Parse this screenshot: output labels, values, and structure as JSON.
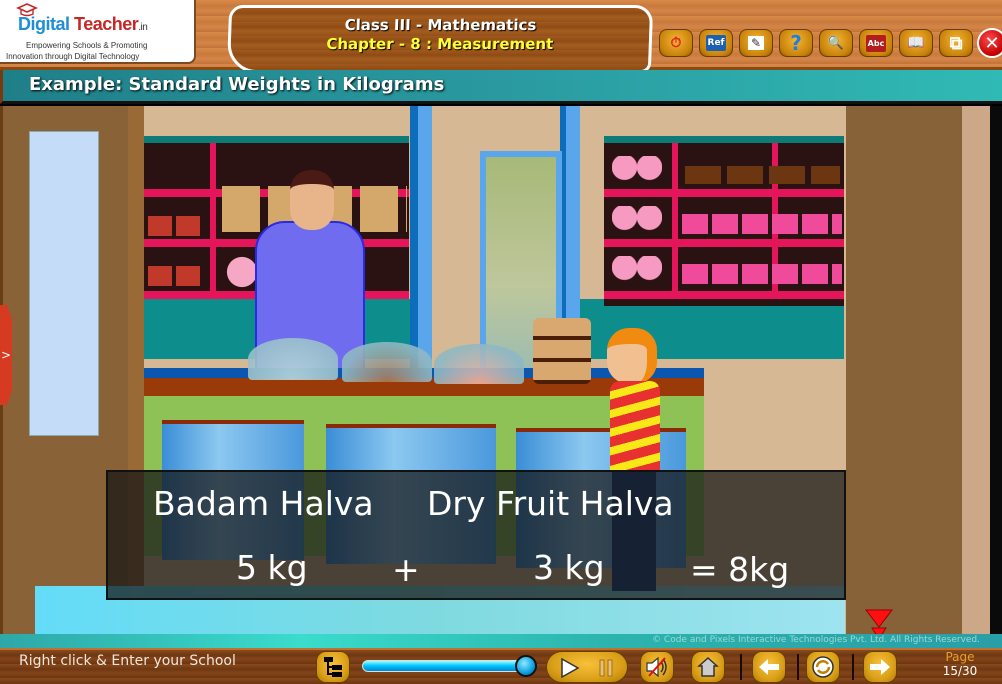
{
  "header": {
    "logo": {
      "brand_part1": "Digital",
      "brand_part2": "Teacher",
      "brand_suffix": ".in",
      "tagline_line1": "Empowering Schools & Promoting",
      "tagline_line2": "Innovation through Digital Technology"
    },
    "title_line1": "Class III - Mathematics",
    "title_line2": "Chapter - 8 : Measurement",
    "toolbar": [
      {
        "name": "history-icon",
        "glyph": "⏱"
      },
      {
        "name": "reference-book-icon",
        "glyph": "Ref"
      },
      {
        "name": "notes-icon",
        "glyph": "✎"
      },
      {
        "name": "help-icon",
        "glyph": "?"
      },
      {
        "name": "zoom-icon",
        "glyph": "🔍"
      },
      {
        "name": "dictionary-icon",
        "glyph": "Abc"
      },
      {
        "name": "open-book-icon",
        "glyph": "📖"
      },
      {
        "name": "window-restore-icon",
        "glyph": "⧉"
      }
    ],
    "close_glyph": "✕"
  },
  "example_title": "Example: Standard Weights in Kilograms",
  "side_tab_glyph": ">",
  "overlay": {
    "item1_name": "Badam Halva",
    "item2_name": "Dry Fruit Halva",
    "item1_weight": "5 kg",
    "operator": "+",
    "item2_weight": "3 kg",
    "result": "= 8kg"
  },
  "footer": {
    "copyright": "© Code and Pixels Interactive Technologies  Pvt. Ltd. All Rights Reserved.",
    "school_prompt": "Right click & Enter your School",
    "progress_fraction": 1.0,
    "page_label": "Page",
    "page_number": "15/30",
    "colors": {
      "accent": "#e8a02a",
      "progress": "#00bfff"
    }
  }
}
